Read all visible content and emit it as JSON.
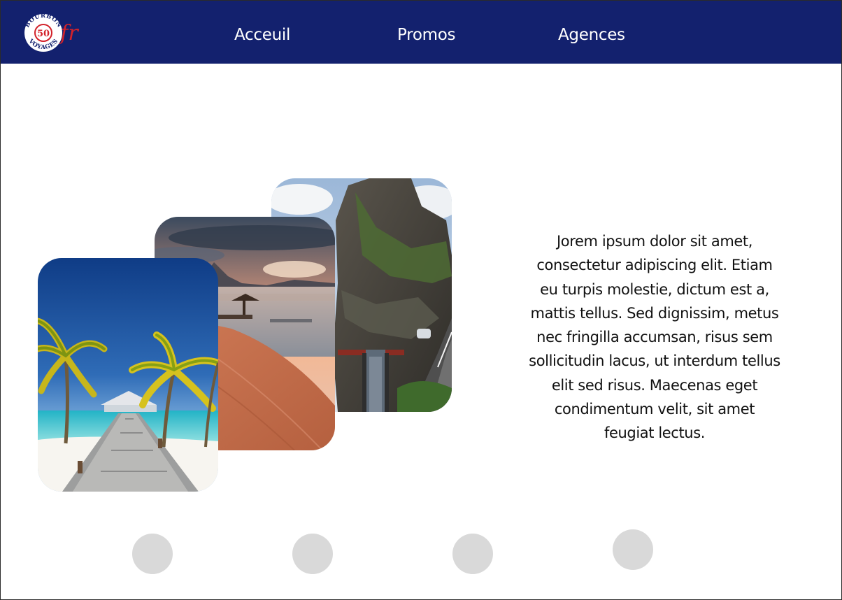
{
  "brand": {
    "logo_top": "BOURBON",
    "logo_bottom": "VOYAGES",
    "logo_number": "50",
    "logo_suffix": "fr"
  },
  "nav": {
    "items": [
      {
        "label": "Acceuil"
      },
      {
        "label": "Promos"
      },
      {
        "label": "Agences"
      }
    ]
  },
  "content": {
    "paragraph": "Jorem ipsum dolor sit amet, consectetur adipiscing elit. Etiam eu turpis molestie, dictum est a, mattis tellus. Sed dignissim, metus nec fringilla accumsan, risus sem sollicitudin lacus, ut interdum tellus elit sed risus. Maecenas eget condimentum velit, sit amet feugiat lectus."
  },
  "gallery": {
    "photos": [
      "cliff-road-photo",
      "sunset-beach-photo",
      "palm-dock-photo"
    ]
  },
  "carousel": {
    "dot_count": 4
  },
  "colors": {
    "header_bg": "#13216e",
    "nav_text": "#ffffff",
    "dot": "#d9d9d9",
    "logo_red": "#d3222a"
  }
}
